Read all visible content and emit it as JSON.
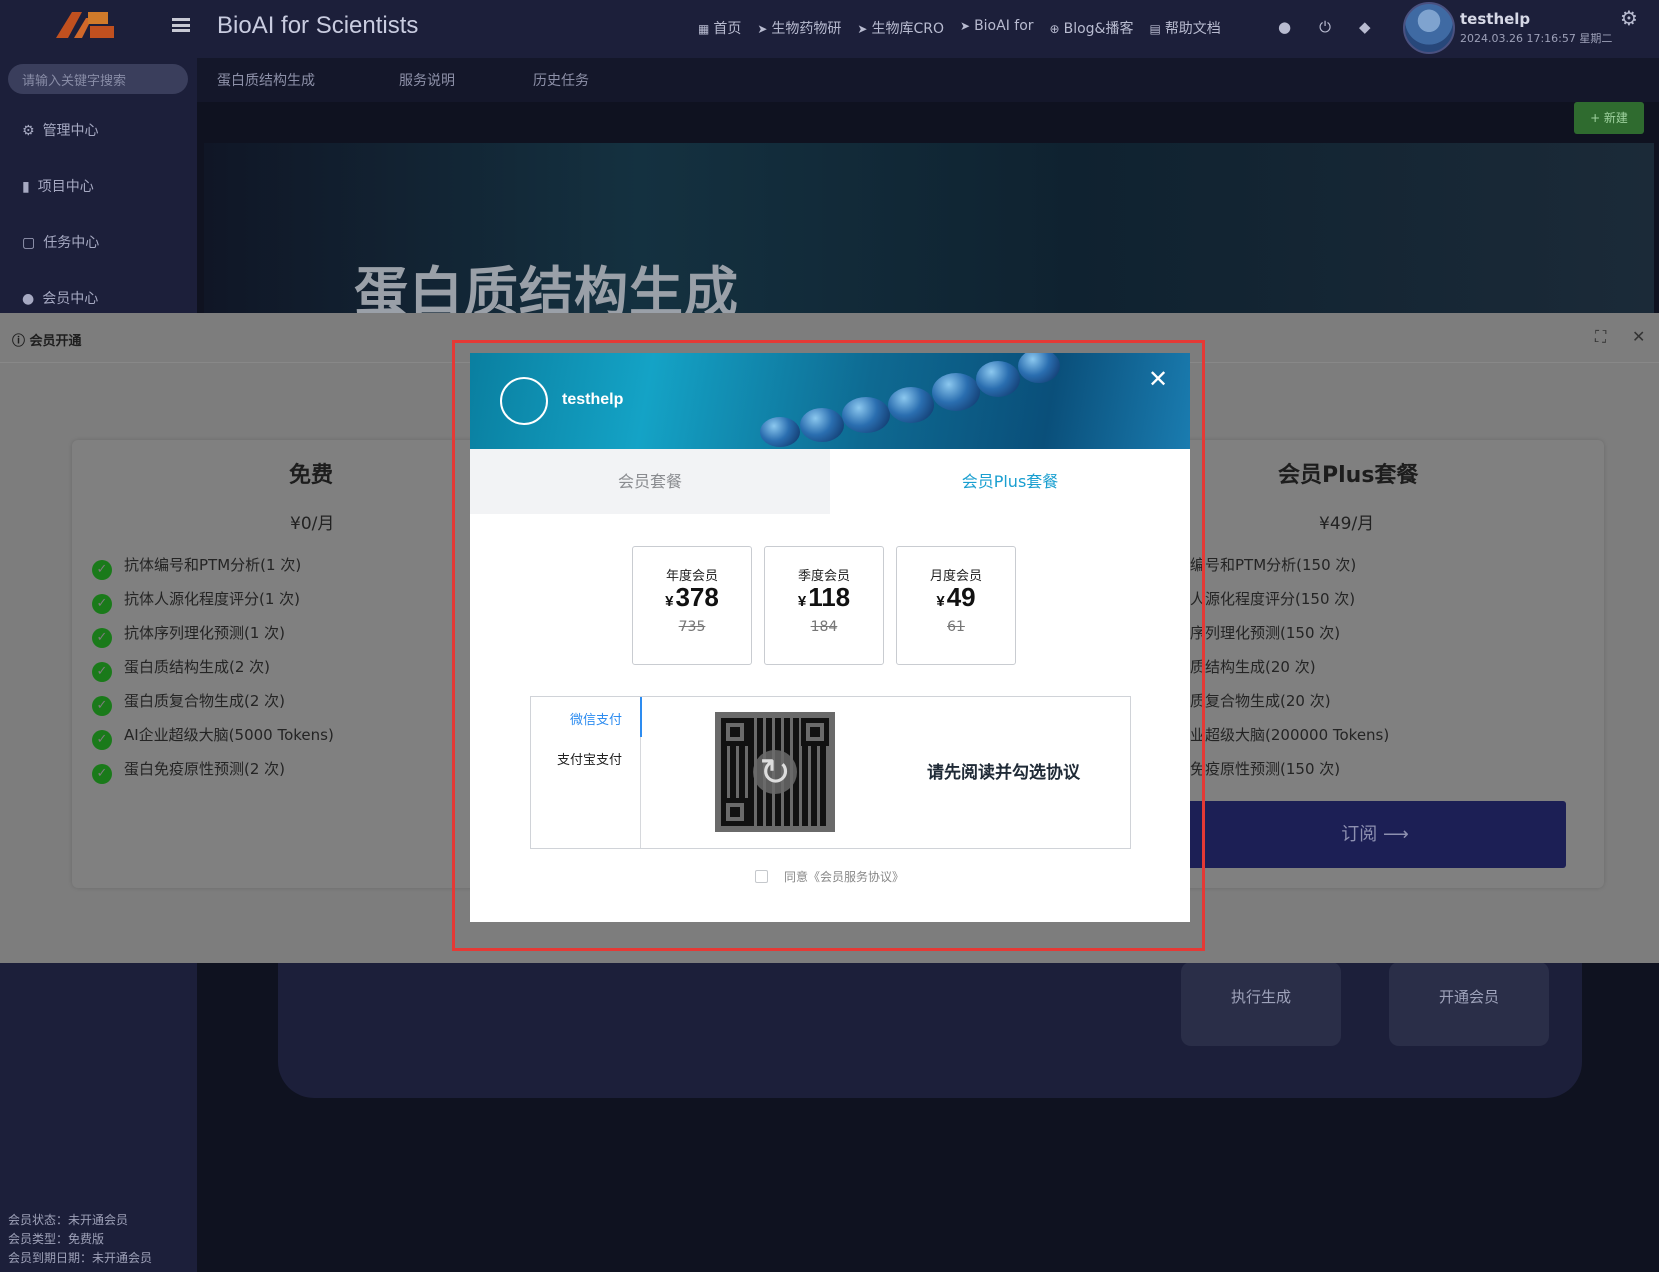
{
  "app": {
    "title": "BioAI for Scientists",
    "nav": [
      {
        "icon": "grid-icon",
        "label": "首页"
      },
      {
        "icon": "send-icon",
        "label": "生物药物研"
      },
      {
        "icon": "send-icon",
        "label": "生物库CRO"
      },
      {
        "icon": "send-icon",
        "label": "BioAI for"
      },
      {
        "icon": "link-icon",
        "label": "Blog&播客"
      },
      {
        "icon": "doc-icon",
        "label": "帮助文档"
      }
    ],
    "user": {
      "name": "testhelp",
      "datetime": "2024.03.26 17:16:57 星期二"
    }
  },
  "sidebar": {
    "search_placeholder": "请输入关键字搜索",
    "items": [
      {
        "icon": "gear-icon",
        "label": "管理中心"
      },
      {
        "icon": "chart-icon",
        "label": "项目中心"
      },
      {
        "icon": "task-icon",
        "label": "任务中心"
      },
      {
        "icon": "user-icon",
        "label": "会员中心"
      }
    ],
    "footer": {
      "status": "会员状态：未开通会员",
      "type": "会员类型：免费版",
      "expiry": "会员到期日期：未开通会员"
    }
  },
  "main": {
    "tabs": [
      "蛋白质结构生成",
      "服务说明",
      "历史任务"
    ],
    "new_button": "+ 新建",
    "hero_title": "蛋白质结构生成",
    "actions": [
      "执行生成",
      "开通会员"
    ]
  },
  "drawer": {
    "title": "会员开通",
    "free_plan": {
      "name": "免费",
      "price": "¥0/月",
      "features": [
        "抗体编号和PTM分析(1 次)",
        "抗体人源化程度评分(1 次)",
        "抗体序列理化预测(1 次)",
        "蛋白质结构生成(2 次)",
        "蛋白质复合物生成(2 次)",
        "AI企业超级大脑(5000 Tokens)",
        "蛋白免疫原性预测(2 次)"
      ]
    },
    "plus_plan": {
      "name": "会员Plus套餐",
      "price": "¥49/月",
      "features": [
        "编号和PTM分析(150 次)",
        "人源化程度评分(150 次)",
        "序列理化预测(150 次)",
        "质结构生成(20 次)",
        "质复合物生成(20 次)",
        "业超级大脑(200000 Tokens)",
        "免疫原性预测(150 次)"
      ],
      "subscribe": "订阅 ⟶"
    }
  },
  "modal": {
    "username": "testhelp",
    "tabs": {
      "basic": "会员套餐",
      "plus": "会员Plus套餐"
    },
    "currency": "¥",
    "plans": [
      {
        "label": "年度会员",
        "price": "378",
        "original": "735"
      },
      {
        "label": "季度会员",
        "price": "118",
        "original": "184"
      },
      {
        "label": "月度会员",
        "price": "49",
        "original": "61"
      }
    ],
    "payment": {
      "wechat": "微信支付",
      "alipay": "支付宝支付",
      "hint": "请先阅读并勾选协议"
    },
    "agreement": "同意《会员服务协议》"
  }
}
